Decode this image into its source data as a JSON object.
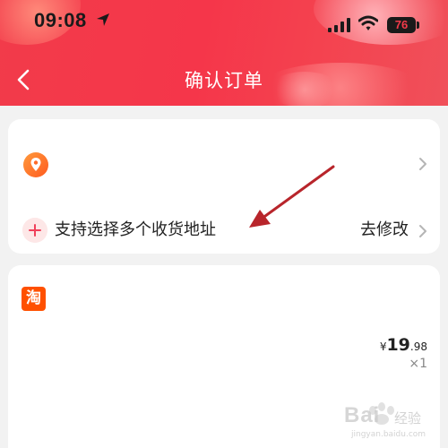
{
  "status_bar": {
    "time": "09:08",
    "battery": "76"
  },
  "header": {
    "title": "确认订单",
    "accent_color": "#f23b4a"
  },
  "address_card": {
    "multi_address_label": "支持选择多个收货地址",
    "modify_link": "去修改"
  },
  "product_card": {
    "shop_logo_char": "淘",
    "price": {
      "currency": "¥",
      "integer": "19",
      "decimal": ".98"
    },
    "quantity": "×1"
  },
  "watermark": {
    "text": "Bai",
    "sub": "经验",
    "url": "jingyan.baidu.com"
  },
  "icons": [
    "location-arrow-icon",
    "signal-icon",
    "wifi-icon",
    "battery-icon",
    "back-icon",
    "location-pin-icon",
    "chevron-right-icon",
    "plus-icon",
    "taobao-logo-icon"
  ]
}
